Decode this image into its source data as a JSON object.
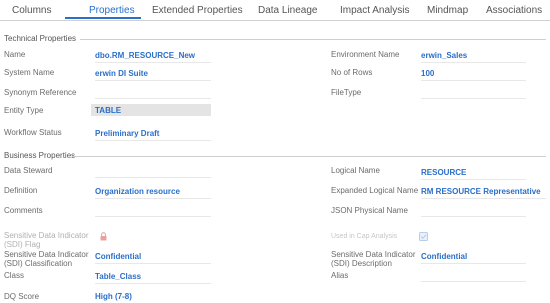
{
  "tabs": [
    "Columns",
    "Properties",
    "Extended Properties",
    "Data Lineage",
    "Impact Analysis",
    "Mindmap",
    "Associations"
  ],
  "active_tab": "Properties",
  "technical": {
    "title": "Technical Properties",
    "name_label": "Name",
    "name_value": "dbo.RM_RESOURCE_New",
    "env_label": "Environment Name",
    "env_value": "erwin_Sales",
    "system_label": "System Name",
    "system_value": "erwin DI Suite",
    "rows_label": "No of Rows",
    "rows_value": "100",
    "synonym_label": "Synonym Reference",
    "filetype_label": "FileType",
    "entity_label": "Entity Type",
    "entity_value": "TABLE",
    "workflow_label": "Workflow Status",
    "workflow_value": "Preliminary Draft"
  },
  "business": {
    "title": "Business Properties",
    "steward_label": "Data Steward",
    "logical_label": "Logical Name",
    "logical_value": "RESOURCE",
    "definition_label": "Definition",
    "definition_value": "Organization resource",
    "expanded_label": "Expanded Logical Name",
    "expanded_value": "RM RESOURCE Representative",
    "comments_label": "Comments",
    "json_label": "JSON Physical Name",
    "sdi_flag_label": "Sensitive Data Indicator (SDI) Flag",
    "cap_label": "Used in Cap Analysis",
    "sdi_class_label": "Sensitive Data Indicator (SDI) Classification",
    "sdi_class_value": "Confidential",
    "sdi_desc_label": "Sensitive Data Indicator (SDI) Description",
    "sdi_desc_value": "Confidential",
    "class_label": "Class",
    "class_value": "Table_Class",
    "alias_label": "Alias",
    "dq_label": "DQ Score",
    "dq_value": "High (7-8)"
  },
  "colors": {
    "accent": "#2a6fc9",
    "lock": "#e8a0a0",
    "check": "#b8cde8"
  },
  "icons": {
    "sdi_flag": "lock-icon",
    "cap_analysis": "check-icon"
  }
}
